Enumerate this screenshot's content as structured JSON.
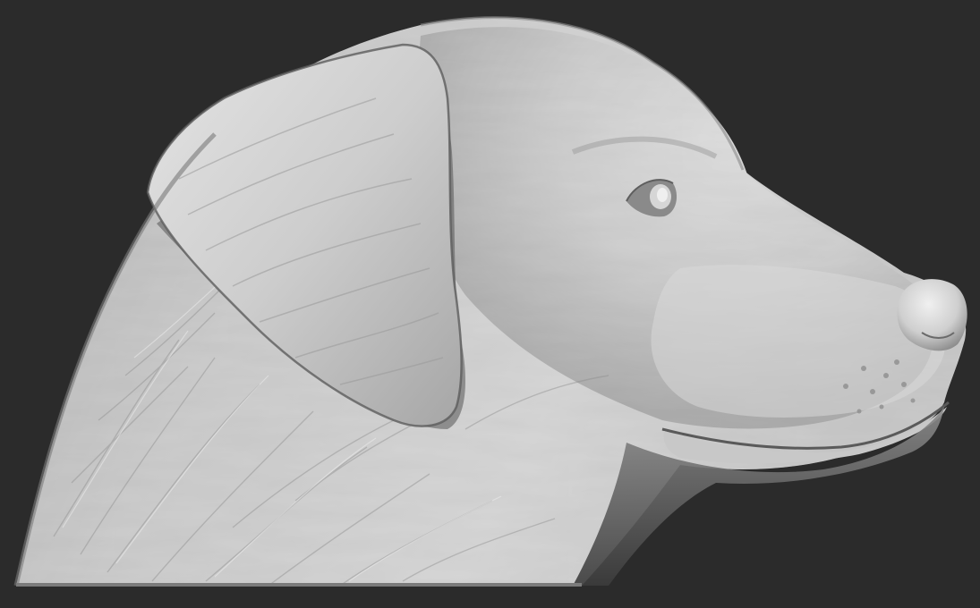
{
  "scene": {
    "subject": "sculpted-dog-head-relief",
    "material": "matcap-grey",
    "colors": {
      "background": "#2b2b2b",
      "clay_light": "#e6e6e6",
      "clay_mid": "#b8b8b8",
      "clay_dark": "#6e6e6e",
      "clay_shadow": "#3a3a3a"
    }
  }
}
